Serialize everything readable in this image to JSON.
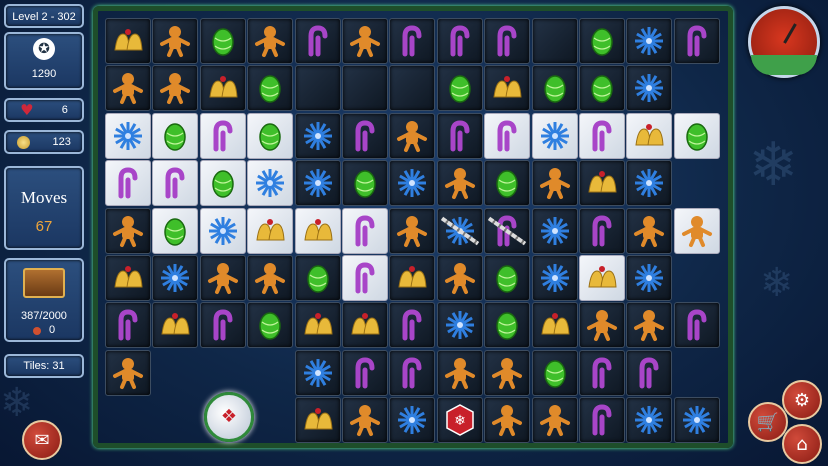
{
  "hud": {
    "level": "Level 2 - 302",
    "score": "1290",
    "hearts": "6",
    "coins": "123",
    "moves_label": "Moves",
    "moves": "67",
    "chest": "387/2000",
    "gems": "0",
    "tiles": "Tiles: 31"
  },
  "board": {
    "rows": [
      [
        "D:bell",
        "D:ginger",
        "D:ornament",
        "D:ginger",
        "D:candy",
        "D:ginger",
        "D:candy",
        "D:candy",
        "D:candy",
        "D:empty",
        "D:ornament",
        "D:snow",
        "D:candy"
      ],
      [
        "D:ginger",
        "D:ginger",
        "D:bell",
        "D:ornament",
        "D:empty",
        "D:empty",
        "D:empty",
        "D:ornament",
        "D:bell",
        "D:ornament",
        "D:ornament",
        "D:snow",
        "X"
      ],
      [
        "L:snow",
        "L:ornament",
        "L:candy",
        "L:ornament",
        "D:snow",
        "D:candy",
        "D:ginger",
        "D:candy",
        "L:candy",
        "L:snow",
        "L:candy",
        "L:bell",
        "L:ornament"
      ],
      [
        "L:candy",
        "L:candy",
        "L:ornament",
        "L:snow",
        "D:snow",
        "D:ornament",
        "D:snow",
        "D:ginger",
        "D:ornament",
        "D:ginger",
        "D:bell",
        "D:snow",
        "X"
      ],
      [
        "D:ginger",
        "L:ornament",
        "L:snow",
        "L:bell",
        "L:bell",
        "L:candy",
        "D:ginger",
        "D:snowchain",
        "D:candychain",
        "D:snow",
        "D:candy",
        "D:ginger",
        "L:ginger"
      ],
      [
        "D:bell",
        "D:snow",
        "D:ginger",
        "D:ginger",
        "D:ornament",
        "L:candy",
        "D:bell",
        "D:ginger",
        "D:ornament",
        "D:snow",
        "L:bell",
        "D:snow",
        "X"
      ],
      [
        "D:candy",
        "D:bell",
        "D:candy",
        "D:ornament",
        "D:bell",
        "D:bell",
        "D:candy",
        "D:snow",
        "D:ornament",
        "D:bell",
        "D:ginger",
        "D:ginger",
        "D:candy"
      ],
      [
        "D:ginger",
        "X",
        "X",
        "X",
        "D:snow",
        "D:candy",
        "D:candy",
        "D:ginger",
        "D:ginger",
        "D:ornament",
        "D:candy",
        "D:candy",
        "X"
      ],
      [
        "X",
        "X",
        "X",
        "X",
        "D:bell",
        "D:ginger",
        "D:snow",
        "D:special",
        "D:ginger",
        "D:ginger",
        "D:candy",
        "D:snow",
        "D:snow"
      ]
    ]
  },
  "colors": {
    "candy": "#a845c8",
    "ornament": "#3fbf2a",
    "snow": "#2f7fe0",
    "ginger": "#e08a2a",
    "bell": "#e8b93a",
    "special": "#c8202a"
  },
  "icons": {
    "score": "medal-icon",
    "hearts": "heart-icon",
    "coins": "coin-icon",
    "chest": "chest-icon",
    "gems": "gem-icon",
    "clock": "clock-icon",
    "settings": "gear-icon",
    "shop": "cart-icon",
    "home": "home-icon",
    "menu": "scroll-icon",
    "hint": "snowball-icon"
  }
}
